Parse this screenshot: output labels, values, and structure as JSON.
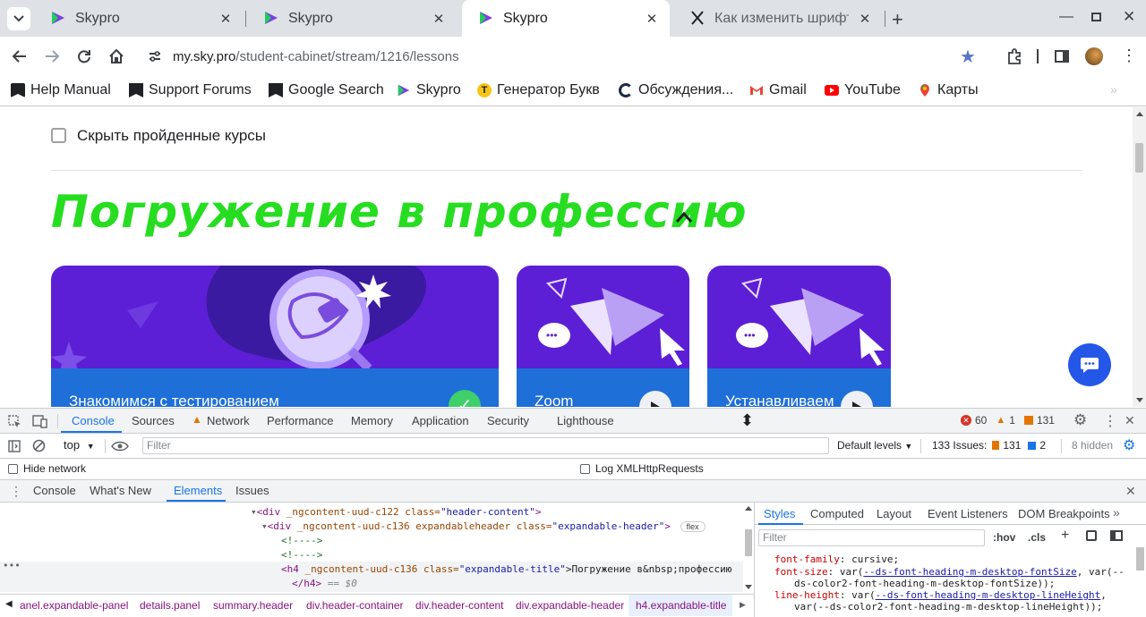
{
  "tabs": [
    {
      "title": "Skypro",
      "active": false
    },
    {
      "title": "Skypro",
      "active": false
    },
    {
      "title": "Skypro",
      "active": true
    },
    {
      "title": "Как изменить шрифт в",
      "active": false
    }
  ],
  "toolbar": {
    "url_host": "my.sky.pro",
    "url_path": "/student-cabinet/stream/1216/lessons"
  },
  "bookmarks": [
    {
      "label": "Help Manual",
      "icon": "bookmark-icon"
    },
    {
      "label": "Support Forums",
      "icon": "bookmark-icon"
    },
    {
      "label": "Google Search",
      "icon": "bookmark-icon"
    },
    {
      "label": "Skypro",
      "icon": "skypro-icon"
    },
    {
      "label": "Генератор Букв",
      "icon": "letter-t-icon"
    },
    {
      "label": "Обсуждения...",
      "icon": "discussion-icon"
    },
    {
      "label": "Gmail",
      "icon": "gmail-icon"
    },
    {
      "label": "YouTube",
      "icon": "youtube-icon"
    },
    {
      "label": "Карты",
      "icon": "maps-icon"
    }
  ],
  "page": {
    "hide_passed_label": "Скрыть пройденные курсы",
    "section_title": "Погружение в профессию",
    "cards": [
      {
        "title": "Знакомимся с тестированием"
      },
      {
        "title": "Zoom"
      },
      {
        "title": "Устанавливаем"
      }
    ]
  },
  "devtools": {
    "tabs": [
      "Console",
      "Sources",
      "Network",
      "Performance",
      "Memory",
      "Application",
      "Security",
      "Lighthouse"
    ],
    "errors": "60",
    "warnings": "1",
    "infos": "131",
    "context": "top",
    "filter_placeholder": "Filter",
    "levels": "Default levels",
    "issues_label": "133 Issues:",
    "issues_warn": "131",
    "issues_info": "2",
    "hidden": "8 hidden",
    "hide_network": "Hide network",
    "log_xhr": "Log XMLHttpRequests",
    "drawer_tabs": [
      "Console",
      "What's New",
      "Elements",
      "Issues"
    ],
    "elements_lines": {
      "l1_tag": "<div",
      "l1_attr": " _ngcontent-uud-c122 class=",
      "l1_val": "\"header-content\"",
      "l1_end": ">",
      "l2_tag": "<div",
      "l2_attr": " _ngcontent-uud-c136 expandableheader class=",
      "l2_val": "\"expandable-header\"",
      "l2_end": ">",
      "l2_badge": "flex",
      "l3": "<!---->",
      "l4": "<!---->",
      "l5_tag": "<h4",
      "l5_attr": " _ngcontent-uud-c136 class=",
      "l5_val": "\"expandable-title\"",
      "l5_text": ">Погружение в&nbsp;профессию",
      "l6": "</h4>",
      "l6_sel": " == $0"
    },
    "breadcrumbs": [
      "anel.expandable-panel",
      "details.panel",
      "summary.header",
      "div.header-container",
      "div.header-content",
      "div.expandable-header",
      "h4.expandable-title"
    ],
    "styles_tabs": [
      "Styles",
      "Computed",
      "Layout",
      "Event Listeners",
      "DOM Breakpoints"
    ],
    "styles_filter": "Filter",
    "hov": ":hov",
    "cls": ".cls",
    "css": {
      "p1_name": "font-family",
      "p1_val": "cursive;",
      "p2_name": "font-size",
      "p2_val_a": "var(",
      "p2_var_a": "--ds-font-heading-m-desktop-fontSize",
      "p2_val_b": ", var(--",
      "p2_cont": "ds-color2-font-heading-m-desktop-fontSize));",
      "p3_name": "line-height",
      "p3_val_a": "var(",
      "p3_var_a": "--ds-font-heading-m-desktop-lineHeight",
      "p3_val_b": ",",
      "p3_cont": "var(--ds-color2-font-heading-m-desktop-lineHeight));"
    }
  }
}
